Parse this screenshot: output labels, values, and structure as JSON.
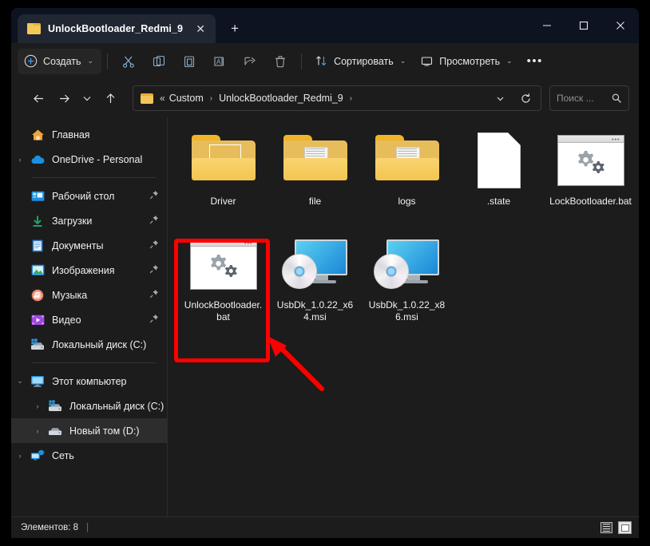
{
  "window": {
    "tab_title": "UnlockBootloader_Redmi_9",
    "tab_icon": "folder-icon",
    "close_tab_label": "✕",
    "new_tab_label": "+",
    "minimize_label": "minimize-icon",
    "maximize_label": "maximize-icon",
    "close_label": "close-icon"
  },
  "toolbar": {
    "new_label": "Создать",
    "new_chevron": "⌄",
    "cut_icon": "scissors-icon",
    "copy_icon": "copy-icon",
    "paste_icon": "paste-icon",
    "rename_icon": "rename-icon",
    "share_icon": "share-icon",
    "delete_icon": "trash-icon",
    "sort_label": "Сортировать",
    "sort_chevron": "⌄",
    "view_label": "Просмотреть",
    "view_chevron": "⌄",
    "more_label": "•••"
  },
  "address": {
    "back_icon": "arrow-left-icon",
    "forward_icon": "arrow-right-icon",
    "recent_icon": "chevron-down-icon",
    "up_icon": "arrow-up-icon",
    "breadcrumb_overflow": "«",
    "breadcrumbs": [
      {
        "label": "Custom"
      },
      {
        "label": "UnlockBootloader_Redmi_9"
      }
    ],
    "separator": "›",
    "dropdown_icon": "chevron-down-icon",
    "refresh_icon": "refresh-icon",
    "search_placeholder": "Поиск ...",
    "search_value": "",
    "search_icon": "search-icon"
  },
  "sidebar": {
    "groups": [
      {
        "items": [
          {
            "label": "Главная",
            "icon": "home-icon",
            "expander": "",
            "pinned": false,
            "indent": 0,
            "selected": false
          },
          {
            "label": "OneDrive - Personal",
            "icon": "cloud-icon",
            "expander": "›",
            "pinned": false,
            "indent": 0,
            "selected": false
          }
        ]
      },
      {
        "items": [
          {
            "label": "Рабочий стол",
            "icon": "desktop-icon",
            "expander": "",
            "pinned": true,
            "indent": 0,
            "selected": false
          },
          {
            "label": "Загрузки",
            "icon": "downloads-icon",
            "expander": "",
            "pinned": true,
            "indent": 0,
            "selected": false
          },
          {
            "label": "Документы",
            "icon": "documents-icon",
            "expander": "",
            "pinned": true,
            "indent": 0,
            "selected": false
          },
          {
            "label": "Изображения",
            "icon": "pictures-icon",
            "expander": "",
            "pinned": true,
            "indent": 0,
            "selected": false
          },
          {
            "label": "Музыка",
            "icon": "music-icon",
            "expander": "",
            "pinned": true,
            "indent": 0,
            "selected": false
          },
          {
            "label": "Видео",
            "icon": "video-icon",
            "expander": "",
            "pinned": true,
            "indent": 0,
            "selected": false
          },
          {
            "label": "Локальный диск (C:)",
            "icon": "drive-windows-icon",
            "expander": "",
            "pinned": false,
            "indent": 0,
            "selected": false
          }
        ]
      },
      {
        "items": [
          {
            "label": "Этот компьютер",
            "icon": "this-pc-icon",
            "expander": "⌄",
            "pinned": false,
            "indent": 0,
            "selected": false
          },
          {
            "label": "Локальный диск (C:)",
            "icon": "drive-windows-icon",
            "expander": "›",
            "pinned": false,
            "indent": 1,
            "selected": false
          },
          {
            "label": "Новый том (D:)",
            "icon": "drive-icon",
            "expander": "›",
            "pinned": false,
            "indent": 1,
            "selected": true
          },
          {
            "label": "Сеть",
            "icon": "network-icon",
            "expander": "›",
            "pinned": false,
            "indent": 0,
            "selected": false
          }
        ]
      }
    ]
  },
  "files": [
    {
      "name": "Driver",
      "type": "folder-driver",
      "highlighted": false
    },
    {
      "name": "file",
      "type": "folder-docs",
      "highlighted": false
    },
    {
      "name": "logs",
      "type": "folder-docs",
      "highlighted": false
    },
    {
      "name": ".state",
      "type": "file-blank",
      "highlighted": false
    },
    {
      "name": "LockBootloader.bat",
      "type": "bat",
      "highlighted": false
    },
    {
      "name": "UnlockBootloader.bat",
      "type": "bat",
      "highlighted": true
    },
    {
      "name": "UsbDk_1.0.22_x64.msi",
      "type": "msi",
      "highlighted": false
    },
    {
      "name": "UsbDk_1.0.22_x86.msi",
      "type": "msi",
      "highlighted": false
    }
  ],
  "statusbar": {
    "items_text": "Элементов: 8",
    "separator": "|",
    "details_view_icon": "details-view-icon",
    "large_icons_view_icon": "large-icons-view-icon"
  },
  "annotation": {
    "color": "#ff0000",
    "rect_target": "UnlockBootloader.bat",
    "arrow": "arrow-pointing-to-unlockbootloader-bat"
  }
}
